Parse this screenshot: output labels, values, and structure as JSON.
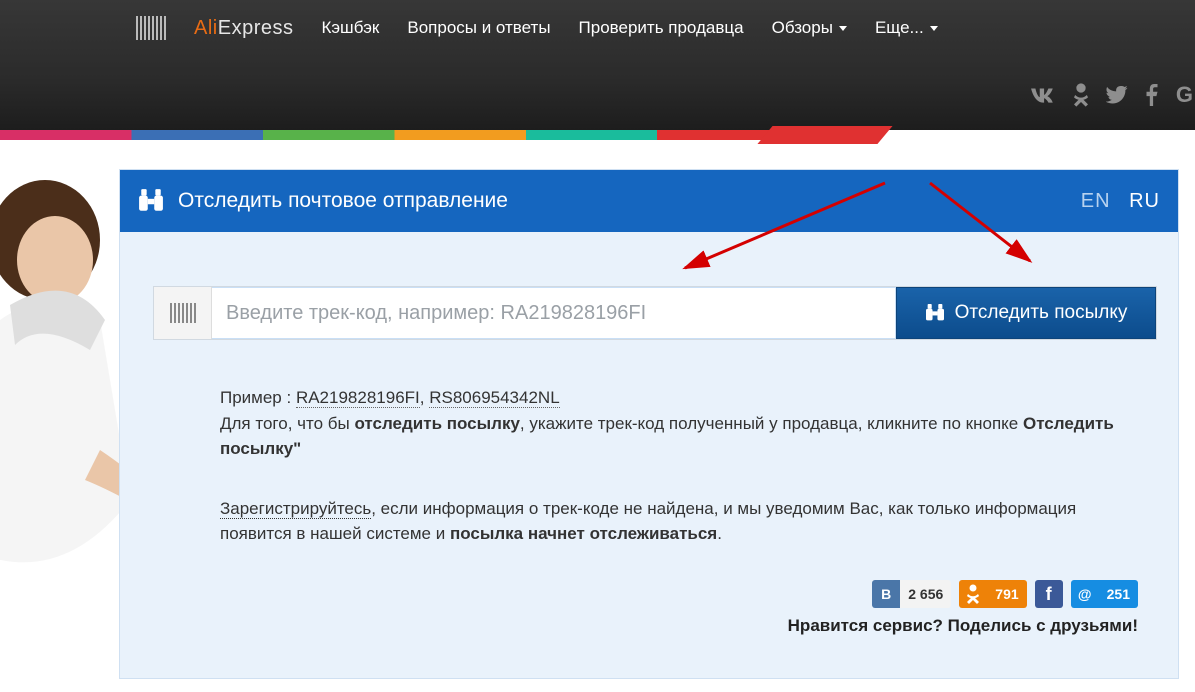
{
  "nav": {
    "logo_a": "Ali",
    "logo_b": "Express",
    "links": [
      "Кэшбэк",
      "Вопросы и ответы",
      "Проверить продавца",
      "Обзоры",
      "Еще..."
    ]
  },
  "social_icons": [
    "vk-icon",
    "ok-icon",
    "twitter-icon",
    "facebook-icon",
    "google-icon"
  ],
  "card": {
    "title": "Отследить почтовое отправление",
    "lang_en": "EN",
    "lang_ru": "RU"
  },
  "search": {
    "placeholder": "Введите трек-код, например: RA219828196FI",
    "button": "Отследить посылку"
  },
  "example": {
    "label": "Пример : ",
    "code1": "RA219828196FI",
    "sep": ", ",
    "code2": "RS806954342NL"
  },
  "para1": {
    "a": "Для того, что бы ",
    "b": "отследить посылку",
    "c": ", укажите трек-код полученный у продавца, кликните по кнопке ",
    "d": "Отследить посылку\""
  },
  "para2": {
    "link": "Зарегистрируйтесь",
    "a": ", если информация о трек-коде не найдена, и мы уведомим Вас, как только информация появится в нашей системе и ",
    "b": "посылка начнет отслеживаться",
    "c": "."
  },
  "share": {
    "vk": "2 656",
    "ok": "791",
    "ml": "251",
    "label": "Нравится сервис? Поделись с друзьями!"
  }
}
